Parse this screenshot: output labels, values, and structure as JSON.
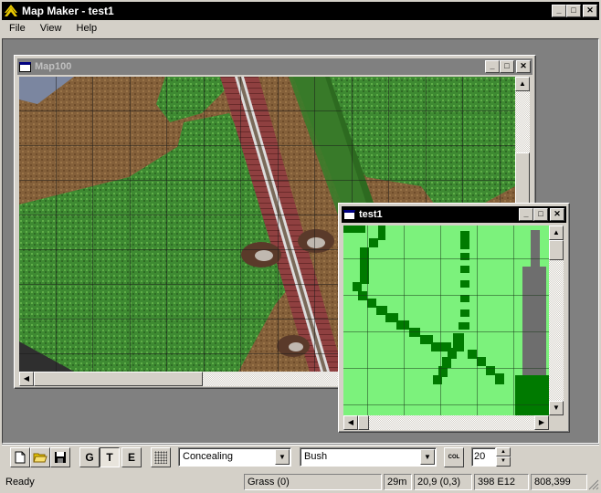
{
  "app": {
    "title": "Map Maker - test1",
    "controls": {
      "minimize": "_",
      "maximize": "□",
      "close": "✕"
    }
  },
  "menu": [
    {
      "label": "File"
    },
    {
      "label": "View"
    },
    {
      "label": "Help"
    }
  ],
  "map_window": {
    "title": "Map100"
  },
  "minimap_window": {
    "title": "test1"
  },
  "toolbar": {
    "mode_g": "G",
    "mode_t": "T",
    "mode_e": "E",
    "terrain_select": "Concealing",
    "object_select": "Bush",
    "col_label": "COL",
    "size_value": "20"
  },
  "status": {
    "ready": "Ready",
    "terrain": "Grass (0)",
    "height": "29m",
    "cell": "20,9 (0,3)",
    "geo": "398 E12",
    "pixel": "808,399"
  },
  "colors": {
    "minimap_light": "#7cf27c",
    "minimap_dark": "#007a00",
    "minimap_gray": "#6e6e6e",
    "title_active": "#000000",
    "title_inactive": "#808080"
  }
}
